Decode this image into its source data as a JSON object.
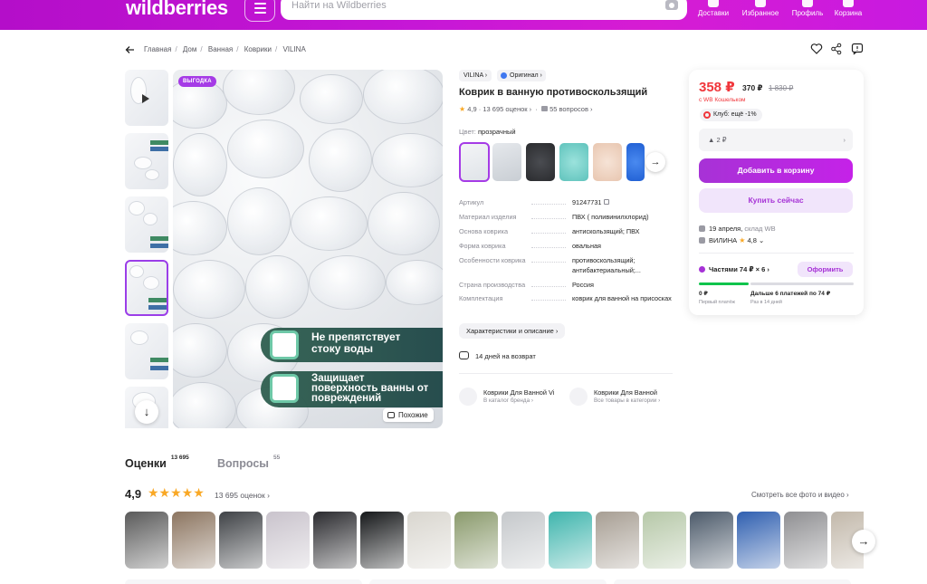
{
  "header": {
    "logo": "wildberries",
    "search_placeholder": "Найти на Wildberries",
    "nav": [
      "Доставки",
      "Избранное",
      "Профиль",
      "Корзина"
    ]
  },
  "breadcrumbs": [
    "Главная",
    "Дом",
    "Ванная",
    "Коврики",
    "VILINA"
  ],
  "gallery": {
    "badge": "ВЫГОДКА",
    "promo_1": "Не препятствует стоку воды",
    "promo_2": "Защищает поверхность ванны от повреждений",
    "similar_label": "Похожие"
  },
  "product": {
    "brand": "VILINA",
    "original": "Оригинал",
    "title": "Коврик в ванную противоскользящий",
    "rating": "4,9",
    "reviews": "13 695 оценок",
    "questions": "55 вопросов",
    "color_label": "Цвет:",
    "color_value": "прозрачный",
    "swatch_colors": [
      "#eef0f3",
      "#d6dbe0",
      "#3a3c40",
      "#7fd6d0",
      "#f2d9c8",
      "#2f6fe0"
    ],
    "specs": [
      {
        "k": "Артикул",
        "v": "91247731"
      },
      {
        "k": "Материал изделия",
        "v": "ПВХ ( поливинилхлорид)"
      },
      {
        "k": "Основа коврика",
        "v": "антискользящий; ПВХ"
      },
      {
        "k": "Форма коврика",
        "v": "овальная"
      },
      {
        "k": "Особенности коврика",
        "v": "противоскользящий; антибактериальный;..."
      },
      {
        "k": "Страна производства",
        "v": "Россия"
      },
      {
        "k": "Комплектация",
        "v": "коврик для ванной на присосках"
      }
    ],
    "char_button": "Характеристики и описание",
    "return_text": "14 дней на возврат",
    "cat1_title": "Коврики Для Ванной Vi",
    "cat1_sub": "В каталог бренда",
    "cat2_title": "Коврики Для Ванной",
    "cat2_sub": "Все товары в категории"
  },
  "buybox": {
    "price": "358 ₽",
    "price_regular": "370 ₽",
    "price_old": "1 830 ₽",
    "wallet": "с WB Кошельком",
    "club": "Клуб: ещё -1%",
    "delivery_price": "2 ₽",
    "add_to_cart": "Добавить в корзину",
    "buy_now": "Купить сейчас",
    "delivery_date": "19 апреля,",
    "warehouse": "склад WB",
    "seller": "ВИЛИНА",
    "seller_rating": "4,8",
    "split_label": "Частями 74 ₽ × 6",
    "split_button": "Оформить",
    "pay_now": "0 ₽",
    "pay_now_sub": "Первый платёж",
    "pay_later": "Дальше 6 платежей по 74 ₽",
    "pay_later_sub": "Раз в 14 дней"
  },
  "reviews_section": {
    "tab_reviews": "Оценки",
    "tab_reviews_count": "13 695",
    "tab_questions": "Вопросы",
    "tab_questions_count": "55",
    "rating": "4,9",
    "stars": "★★★★★",
    "count": "13 695 оценок",
    "see_all": "Смотреть все фото и видео",
    "photo_colors": [
      "#5a5a5a",
      "#8c7560",
      "#3f4246",
      "#c9c3cc",
      "#2a2a2e",
      "#16181a",
      "#d9d6cf",
      "#8a9a6c",
      "#c5c8cb",
      "#3fb5ad",
      "#a79e93",
      "#b6c8a8",
      "#4c5a6a",
      "#2f5fb0",
      "#8f8f92",
      "#c2b8aa"
    ]
  }
}
